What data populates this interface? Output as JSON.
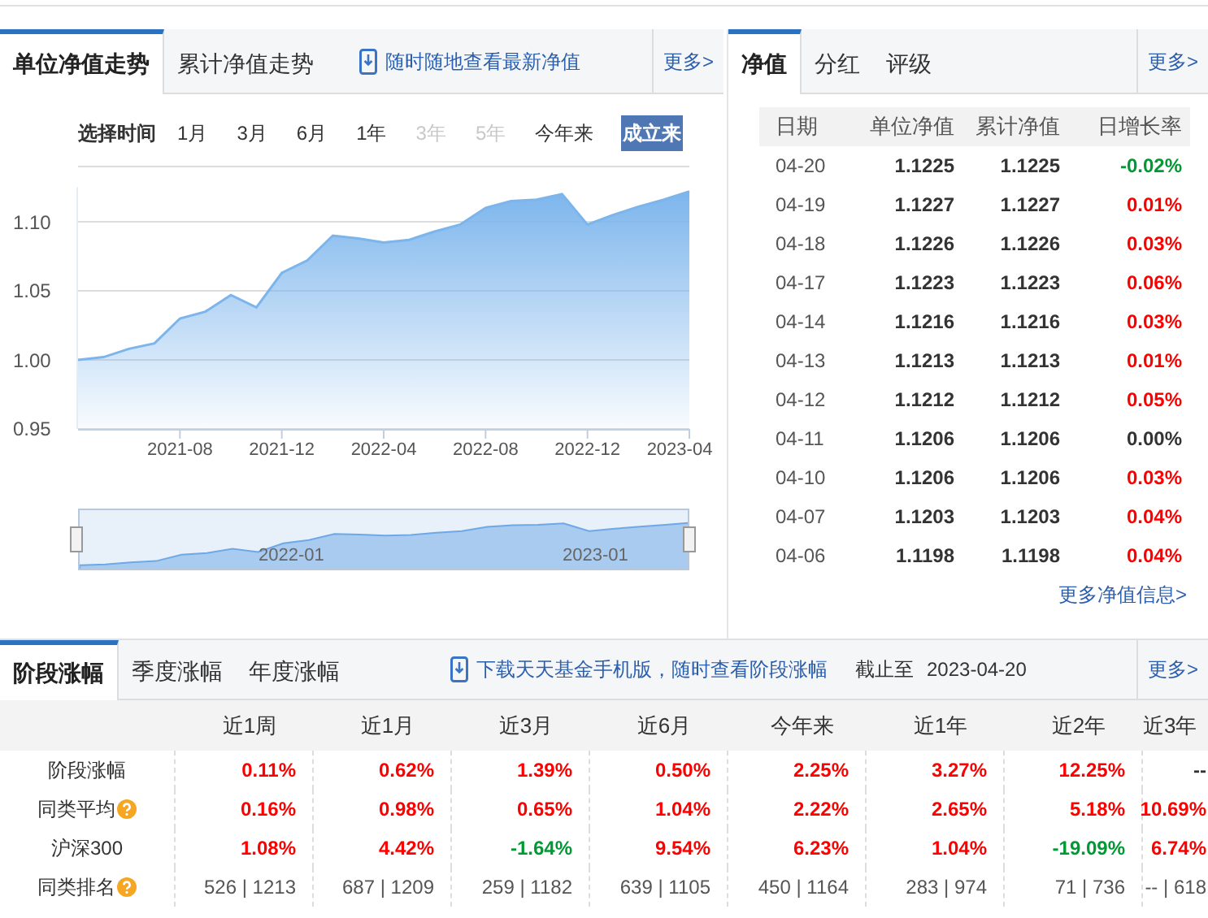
{
  "fund_chart": {
    "tabs": [
      {
        "label": "单位净值走势",
        "selected": true
      },
      {
        "label": "累计净值走势",
        "selected": false
      }
    ],
    "promo_link": "随时随地查看最新净值",
    "more_link": "更多>",
    "time_range": {
      "label": "选择时间",
      "options": [
        {
          "label": "1月",
          "selected": false,
          "disabled": false
        },
        {
          "label": "3月",
          "selected": false,
          "disabled": false
        },
        {
          "label": "6月",
          "selected": false,
          "disabled": false
        },
        {
          "label": "1年",
          "selected": false,
          "disabled": false
        },
        {
          "label": "3年",
          "selected": false,
          "disabled": true
        },
        {
          "label": "5年",
          "selected": false,
          "disabled": true
        },
        {
          "label": "今年来",
          "selected": false,
          "disabled": false
        },
        {
          "label": "成立来",
          "selected": true,
          "disabled": false
        }
      ]
    },
    "chart_data": {
      "type": "area",
      "grid": true,
      "categories": [
        null,
        null,
        null,
        null,
        "2021-08",
        null,
        null,
        null,
        "2021-12",
        null,
        null,
        null,
        "2022-04",
        null,
        null,
        null,
        "2022-08",
        null,
        null,
        null,
        "2022-12",
        null,
        null,
        null,
        "2023-04"
      ],
      "series": [
        {
          "color": "#7cb5ec",
          "values": [
            1.0,
            1.002,
            1.008,
            1.012,
            1.03,
            1.035,
            1.047,
            1.038,
            1.063,
            1.072,
            1.09,
            1.088,
            1.085,
            1.087,
            1.093,
            1.098,
            1.11,
            1.115,
            1.116,
            1.12,
            1.098,
            1.105,
            1.111,
            1.116,
            1.122
          ]
        }
      ],
      "ylim": [
        0.95,
        1.125
      ],
      "yticks": [
        {
          "value": 0.95,
          "label": "0.95"
        },
        {
          "value": 1.0,
          "label": "1.00"
        },
        {
          "value": 1.05,
          "label": "1.05"
        },
        {
          "value": 1.1,
          "label": "1.10"
        }
      ]
    },
    "navigator": {
      "labels": [
        "2022-01",
        "2023-01"
      ]
    }
  },
  "nav_panel": {
    "tabs": [
      {
        "label": "净值",
        "selected": true
      },
      {
        "label": "分红",
        "selected": false
      },
      {
        "label": "评级",
        "selected": false
      }
    ],
    "more_link": "更多>",
    "columns": [
      "日期",
      "单位净值",
      "累计净值",
      "日增长率"
    ],
    "rows": [
      {
        "date": "04-20",
        "unit_nav": "1.1225",
        "cumulative_nav": "1.1225",
        "daily_growth": "-0.02%",
        "color": "#009933"
      },
      {
        "date": "04-19",
        "unit_nav": "1.1227",
        "cumulative_nav": "1.1227",
        "daily_growth": "0.01%",
        "color": "#ff0000"
      },
      {
        "date": "04-18",
        "unit_nav": "1.1226",
        "cumulative_nav": "1.1226",
        "daily_growth": "0.03%",
        "color": "#ff0000"
      },
      {
        "date": "04-17",
        "unit_nav": "1.1223",
        "cumulative_nav": "1.1223",
        "daily_growth": "0.06%",
        "color": "#ff0000"
      },
      {
        "date": "04-14",
        "unit_nav": "1.1216",
        "cumulative_nav": "1.1216",
        "daily_growth": "0.03%",
        "color": "#ff0000"
      },
      {
        "date": "04-13",
        "unit_nav": "1.1213",
        "cumulative_nav": "1.1213",
        "daily_growth": "0.01%",
        "color": "#ff0000"
      },
      {
        "date": "04-12",
        "unit_nav": "1.1212",
        "cumulative_nav": "1.1212",
        "daily_growth": "0.05%",
        "color": "#ff0000"
      },
      {
        "date": "04-11",
        "unit_nav": "1.1206",
        "cumulative_nav": "1.1206",
        "daily_growth": "0.00%",
        "color": "#333333"
      },
      {
        "date": "04-10",
        "unit_nav": "1.1206",
        "cumulative_nav": "1.1206",
        "daily_growth": "0.03%",
        "color": "#ff0000"
      },
      {
        "date": "04-07",
        "unit_nav": "1.1203",
        "cumulative_nav": "1.1203",
        "daily_growth": "0.04%",
        "color": "#ff0000"
      },
      {
        "date": "04-06",
        "unit_nav": "1.1198",
        "cumulative_nav": "1.1198",
        "daily_growth": "0.04%",
        "color": "#ff0000"
      }
    ],
    "more_info_link": "更多净值信息>"
  },
  "returns": {
    "tabs": [
      {
        "label": "阶段涨幅",
        "selected": true
      },
      {
        "label": "季度涨幅",
        "selected": false
      },
      {
        "label": "年度涨幅",
        "selected": false
      }
    ],
    "promo_link": "下载天天基金手机版，随时查看阶段涨幅",
    "as_of_label": "截止至",
    "as_of_date": "2023-04-20",
    "more_link": "更多>",
    "columns": [
      "近1周",
      "近1月",
      "近3月",
      "近6月",
      "今年来",
      "近1年",
      "近2年",
      "近3年"
    ],
    "rows": [
      {
        "label": "阶段涨幅",
        "help": false,
        "kind": "percent",
        "cells": [
          {
            "text": "0.11%",
            "color": "#ff0000"
          },
          {
            "text": "0.62%",
            "color": "#ff0000"
          },
          {
            "text": "1.39%",
            "color": "#ff0000"
          },
          {
            "text": "0.50%",
            "color": "#ff0000"
          },
          {
            "text": "2.25%",
            "color": "#ff0000"
          },
          {
            "text": "3.27%",
            "color": "#ff0000"
          },
          {
            "text": "12.25%",
            "color": "#ff0000"
          },
          {
            "text": "--",
            "color": "#333333"
          }
        ]
      },
      {
        "label": "同类平均",
        "help": true,
        "kind": "percent",
        "cells": [
          {
            "text": "0.16%",
            "color": "#ff0000"
          },
          {
            "text": "0.98%",
            "color": "#ff0000"
          },
          {
            "text": "0.65%",
            "color": "#ff0000"
          },
          {
            "text": "1.04%",
            "color": "#ff0000"
          },
          {
            "text": "2.22%",
            "color": "#ff0000"
          },
          {
            "text": "2.65%",
            "color": "#ff0000"
          },
          {
            "text": "5.18%",
            "color": "#ff0000"
          },
          {
            "text": "10.69%",
            "color": "#ff0000"
          }
        ]
      },
      {
        "label": "沪深300",
        "help": false,
        "kind": "percent",
        "cells": [
          {
            "text": "1.08%",
            "color": "#ff0000"
          },
          {
            "text": "4.42%",
            "color": "#ff0000"
          },
          {
            "text": "-1.64%",
            "color": "#009933"
          },
          {
            "text": "9.54%",
            "color": "#ff0000"
          },
          {
            "text": "6.23%",
            "color": "#ff0000"
          },
          {
            "text": "1.04%",
            "color": "#ff0000"
          },
          {
            "text": "-19.09%",
            "color": "#009933"
          },
          {
            "text": "6.74%",
            "color": "#ff0000"
          }
        ]
      },
      {
        "label": "同类排名",
        "help": true,
        "kind": "rank",
        "cells": [
          {
            "text": "526 | 1213"
          },
          {
            "text": "687 | 1209"
          },
          {
            "text": "259 | 1182"
          },
          {
            "text": "639 | 1105"
          },
          {
            "text": "450 | 1164"
          },
          {
            "text": "283 | 974"
          },
          {
            "text": "71 | 736"
          },
          {
            "text": "-- | 618"
          }
        ]
      }
    ]
  }
}
